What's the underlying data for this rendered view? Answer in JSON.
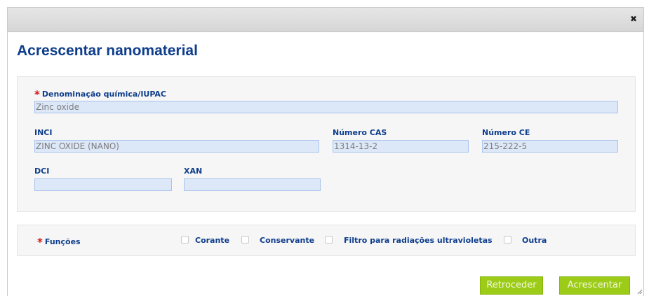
{
  "dialog": {
    "close_glyph": "✖",
    "title": "Acrescentar nanomaterial"
  },
  "form": {
    "required_mark": "*",
    "chemical_name": {
      "label": "Denominação química/IUPAC",
      "value": "Zinc oxide"
    },
    "inci": {
      "label": "INCI",
      "value": "ZINC OXIDE (NANO)"
    },
    "cas": {
      "label": "Número CAS",
      "value": "1314-13-2"
    },
    "ce": {
      "label": "Número CE",
      "value": "215-222-5"
    },
    "dci": {
      "label": "DCI",
      "value": ""
    },
    "xan": {
      "label": "XAN",
      "value": ""
    }
  },
  "functions": {
    "label": "Funções",
    "options": [
      {
        "label": "Corante",
        "checked": false
      },
      {
        "label": "Conservante",
        "checked": false
      },
      {
        "label": "Filtro para radiações ultravioletas",
        "checked": false
      },
      {
        "label": "Outra",
        "checked": false
      }
    ]
  },
  "buttons": {
    "back": "Retroceder",
    "add": "Acrescentar"
  },
  "colors": {
    "title_blue": "#0e3d8c",
    "required_red": "#d01a1a",
    "field_bg": "#dce7f8",
    "button_green": "#9ccc17"
  }
}
